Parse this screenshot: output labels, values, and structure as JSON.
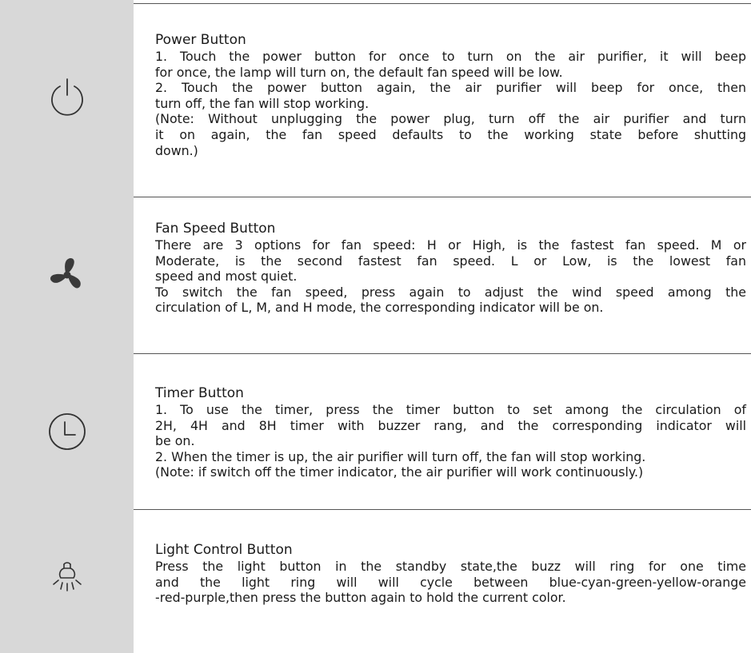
{
  "sections": [
    {
      "icon": "power-icon",
      "title": "Power Button",
      "lines": [
        "1. Touch the power button for once to turn on the air purifier, it will beep",
        "for once, the lamp will turn on, the default fan speed will be low.",
        "2. Touch the power button again, the air purifier will beep for once, then",
        "turn off, the fan will stop working.",
        "(Note: Without unplugging the power plug, turn off the air purifier and turn",
        "it on again, the fan speed defaults to the working state before shutting",
        "down.)"
      ]
    },
    {
      "icon": "fan-icon",
      "title": "Fan Speed Button",
      "lines": [
        "There are 3 options for fan speed: H or High, is the fastest fan speed. M or",
        "Moderate, is the second fastest fan speed. L or Low, is the lowest fan",
        "speed and most quiet.",
        "To switch the fan speed, press again to adjust the wind speed among the",
        "circulation of L, M, and H mode, the corresponding indicator will be on."
      ]
    },
    {
      "icon": "clock-icon",
      "title": "Timer Button",
      "lines": [
        "1. To use the timer, press the timer button to set among the circulation of",
        "2H, 4H and 8H timer with buzzer rang, and the corresponding indicator will",
        "be on.",
        "2. When the timer is up, the air purifier will turn off, the fan will stop working.",
        "(Note: if switch off the timer indicator, the air purifier will work continuously.)"
      ]
    },
    {
      "icon": "light-bulb-icon",
      "title": "Light Control Button",
      "lines": [
        "Press the light button in the standby state,the buzz will ring for one time",
        "and the light ring will will cycle between blue-cyan-green-yellow-orange",
        "-red-purple,then press the button again to hold the current color."
      ]
    }
  ]
}
